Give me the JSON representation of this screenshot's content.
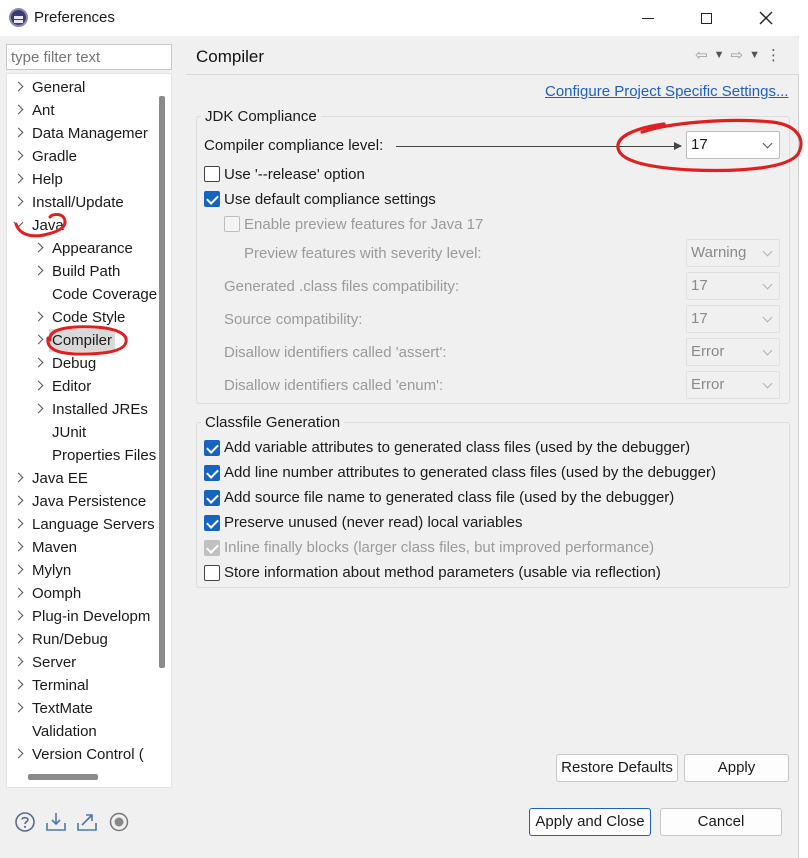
{
  "window": {
    "title": "Preferences"
  },
  "filter": {
    "placeholder": "type filter text"
  },
  "tree": {
    "items": [
      {
        "label": "General",
        "level": 0,
        "expand": "closed"
      },
      {
        "label": "Ant",
        "level": 0,
        "expand": "closed"
      },
      {
        "label": "Data Managemer",
        "level": 0,
        "expand": "closed"
      },
      {
        "label": "Gradle",
        "level": 0,
        "expand": "closed"
      },
      {
        "label": "Help",
        "level": 0,
        "expand": "closed"
      },
      {
        "label": "Install/Update",
        "level": 0,
        "expand": "closed"
      },
      {
        "label": "Java",
        "level": 0,
        "expand": "open"
      },
      {
        "label": "Appearance",
        "level": 1,
        "expand": "closed"
      },
      {
        "label": "Build Path",
        "level": 1,
        "expand": "closed"
      },
      {
        "label": "Code Coverage",
        "level": 1,
        "expand": "none"
      },
      {
        "label": "Code Style",
        "level": 1,
        "expand": "closed"
      },
      {
        "label": "Compiler",
        "level": 1,
        "expand": "closed",
        "selected": true
      },
      {
        "label": "Debug",
        "level": 1,
        "expand": "closed"
      },
      {
        "label": "Editor",
        "level": 1,
        "expand": "closed"
      },
      {
        "label": "Installed JREs",
        "level": 1,
        "expand": "closed"
      },
      {
        "label": "JUnit",
        "level": 1,
        "expand": "none"
      },
      {
        "label": "Properties Files",
        "level": 1,
        "expand": "none"
      },
      {
        "label": "Java EE",
        "level": 0,
        "expand": "closed"
      },
      {
        "label": "Java Persistence",
        "level": 0,
        "expand": "closed"
      },
      {
        "label": "Language Servers",
        "level": 0,
        "expand": "closed"
      },
      {
        "label": "Maven",
        "level": 0,
        "expand": "closed"
      },
      {
        "label": "Mylyn",
        "level": 0,
        "expand": "closed"
      },
      {
        "label": "Oomph",
        "level": 0,
        "expand": "closed"
      },
      {
        "label": "Plug-in Developm",
        "level": 0,
        "expand": "closed"
      },
      {
        "label": "Run/Debug",
        "level": 0,
        "expand": "closed"
      },
      {
        "label": "Server",
        "level": 0,
        "expand": "closed"
      },
      {
        "label": "Terminal",
        "level": 0,
        "expand": "closed"
      },
      {
        "label": "TextMate",
        "level": 0,
        "expand": "closed"
      },
      {
        "label": "Validation",
        "level": 0,
        "expand": "none"
      },
      {
        "label": "Version Control (",
        "level": 0,
        "expand": "closed"
      }
    ]
  },
  "page": {
    "title": "Compiler",
    "configure_link": "Configure Project Specific Settings..."
  },
  "jdk": {
    "group_title": "JDK Compliance",
    "compliance_label": "Compiler compliance level:",
    "compliance_value": "17",
    "release_option": {
      "label": "Use '--release' option",
      "checked": false
    },
    "default_compliance": {
      "label": "Use default compliance settings",
      "checked": true
    },
    "preview": {
      "label": "Enable preview features for Java 17",
      "checked": false
    },
    "preview_severity": {
      "label": "Preview features with severity level:",
      "value": "Warning"
    },
    "generated_class": {
      "label": "Generated .class files compatibility:",
      "value": "17"
    },
    "source_compat": {
      "label": "Source compatibility:",
      "value": "17"
    },
    "assert_ids": {
      "label": "Disallow identifiers called 'assert':",
      "value": "Error"
    },
    "enum_ids": {
      "label": "Disallow identifiers called 'enum':",
      "value": "Error"
    }
  },
  "classfile": {
    "group_title": "Classfile Generation",
    "options": [
      {
        "label": "Add variable attributes to generated class files (used by the debugger)",
        "checked": true,
        "disabled": false
      },
      {
        "label": "Add line number attributes to generated class files (used by the debugger)",
        "checked": true,
        "disabled": false
      },
      {
        "label": "Add source file name to generated class file (used by the debugger)",
        "checked": true,
        "disabled": false
      },
      {
        "label": "Preserve unused (never read) local variables",
        "checked": true,
        "disabled": false
      },
      {
        "label": "Inline finally blocks (larger class files, but improved performance)",
        "checked": true,
        "disabled": true
      },
      {
        "label": "Store information about method parameters (usable via reflection)",
        "checked": false,
        "disabled": false
      }
    ]
  },
  "buttons": {
    "restore_defaults": "Restore Defaults",
    "apply": "Apply",
    "apply_close": "Apply and Close",
    "cancel": "Cancel"
  },
  "colors": {
    "annotation": "#e02020",
    "accent": "#1565c0",
    "link": "#1f5fbf"
  }
}
